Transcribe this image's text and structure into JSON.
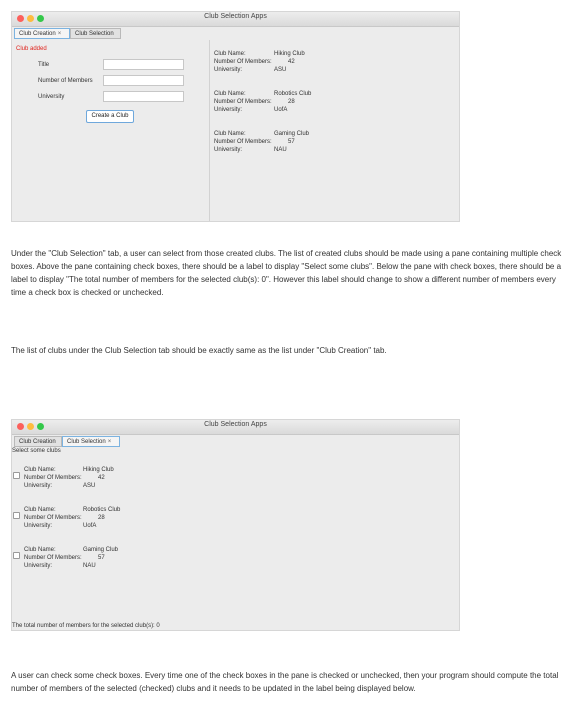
{
  "window1": {
    "title": "Club Selection Apps",
    "tabs": [
      {
        "label": "Club Creation",
        "close": "×"
      },
      {
        "label": "Club Selection"
      }
    ],
    "status": "Club added",
    "form": {
      "title_label": "Title",
      "members_label": "Number of Members",
      "university_label": "University",
      "title_value": "",
      "members_value": "",
      "university_value": "",
      "button": "Create a Club"
    },
    "clubs": [
      {
        "name_label": "Club Name:",
        "name": "Hiking Club",
        "members_label": "Number Of Members:",
        "members": "42",
        "uni_label": "University:",
        "uni": "ASU"
      },
      {
        "name_label": "Club Name:",
        "name": "Robotics Club",
        "members_label": "Number Of Members:",
        "members": "28",
        "uni_label": "University:",
        "uni": "UofA"
      },
      {
        "name_label": "Club Name:",
        "name": "Gaming Club",
        "members_label": "Number Of Members:",
        "members": "57",
        "uni_label": "University:",
        "uni": "NAU"
      }
    ]
  },
  "paragraphs": {
    "p1": "Under the \"Club Selection\" tab, a user can select from those created clubs. The list of created clubs should be made using a pane containing multiple check boxes. Above the pane containing check boxes, there should be a label to display \"Select some clubs\". Below the pane with check boxes, there should be a label to display \"The total number of members for the selected club(s): 0\". However this label should change to show a different number of members every time a check box is checked or unchecked.",
    "p2": "The list of clubs under the Club Selection tab should be exactly same as the list under \"Club Creation\" tab.",
    "p3": "A user can check some check boxes. Every time one of the check boxes in the pane is checked or unchecked, then your program should compute the total number of members of the selected (checked) clubs and it needs to be updated in the label being displayed below."
  },
  "window2": {
    "title": "Club Selection Apps",
    "tabs": [
      {
        "label": "Club Creation"
      },
      {
        "label": "Club Selection",
        "close": "×"
      }
    ],
    "select_label": "Select some clubs",
    "clubs": [
      {
        "name_label": "Club Name:",
        "name": "Hiking Club",
        "members_label": "Number Of Members:",
        "members": "42",
        "uni_label": "University:",
        "uni": "ASU",
        "checked": false
      },
      {
        "name_label": "Club Name:",
        "name": "Robotics Club",
        "members_label": "Number Of Members:",
        "members": "28",
        "uni_label": "University:",
        "uni": "UofA",
        "checked": false
      },
      {
        "name_label": "Club Name:",
        "name": "Gaming Club",
        "members_label": "Number Of Members:",
        "members": "57",
        "uni_label": "University:",
        "uni": "NAU",
        "checked": false
      }
    ],
    "total_label": "The total number of members for the selected club(s): 0"
  }
}
